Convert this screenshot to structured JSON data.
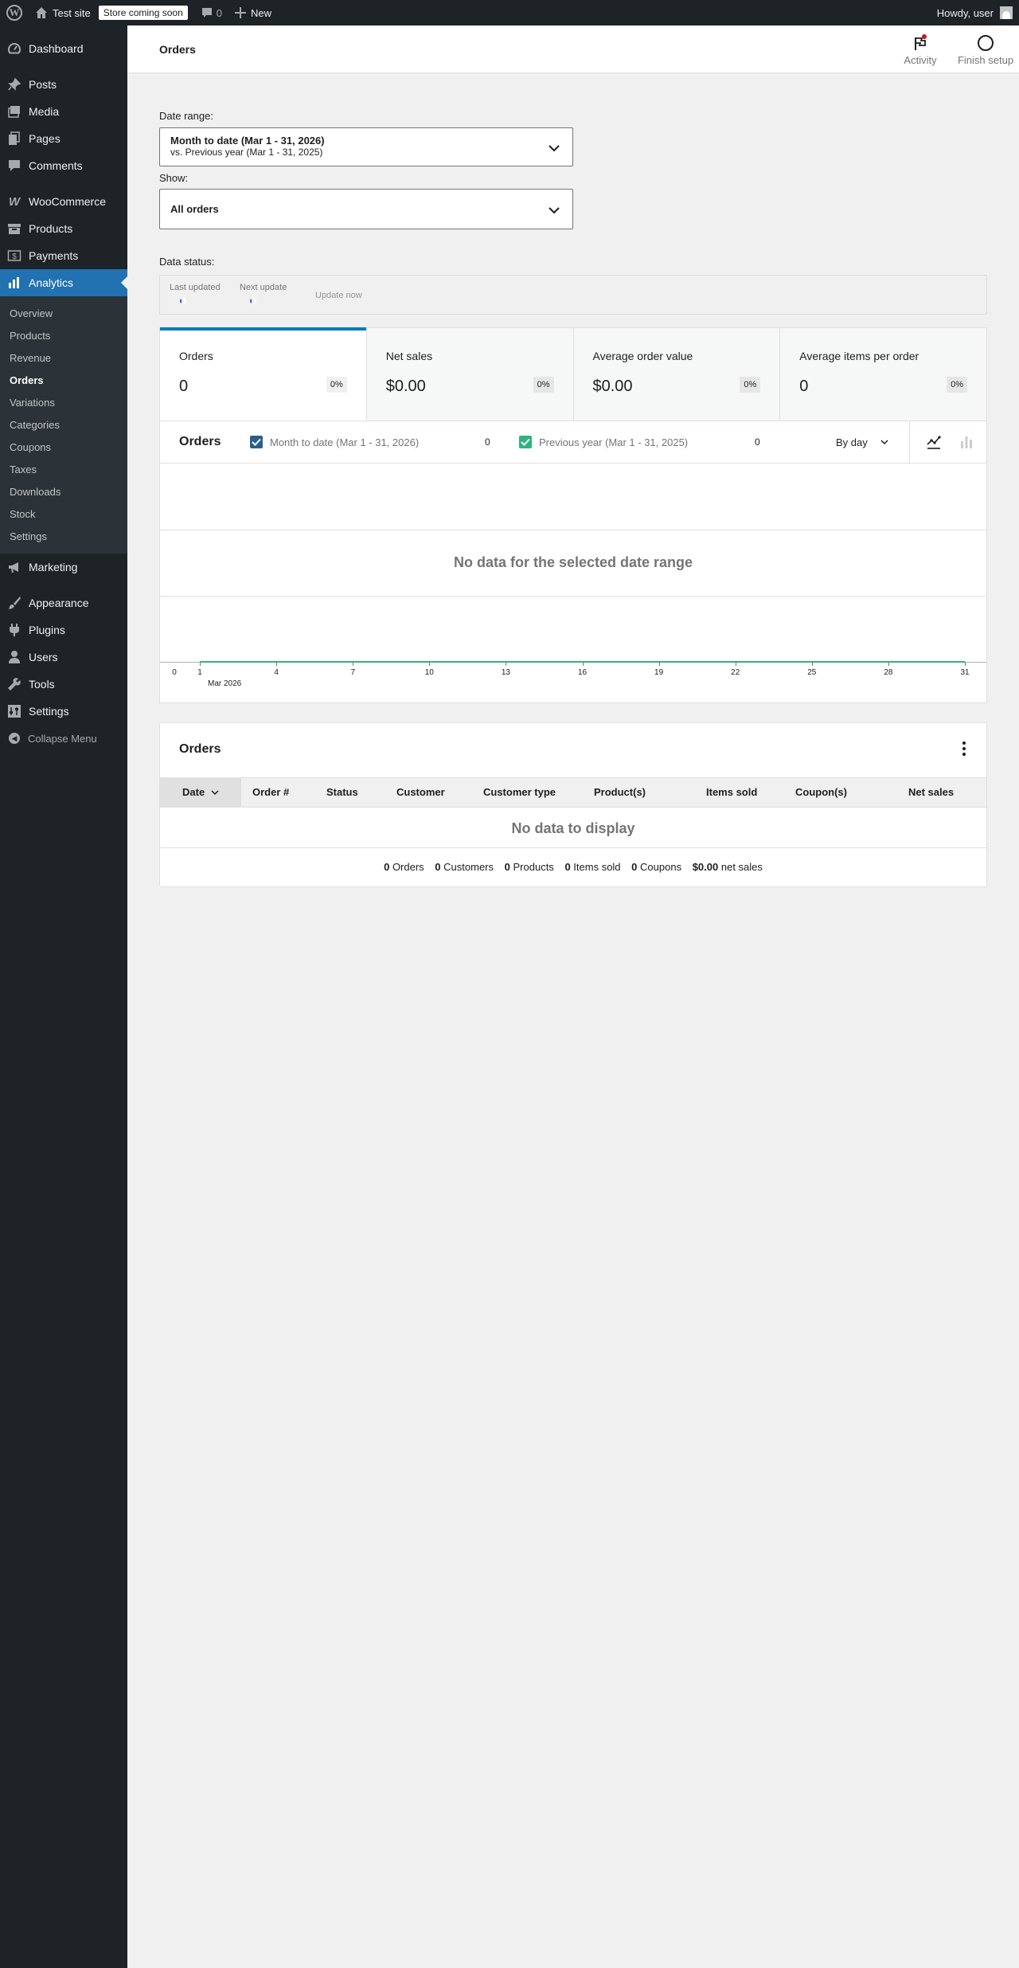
{
  "adminbar": {
    "site_name": "Test site",
    "store_badge": "Store coming soon",
    "comments_count": "0",
    "new_label": "New",
    "howdy": "Howdy, user"
  },
  "sidebar": {
    "items": [
      {
        "label": "Dashboard",
        "icon": "dashboard-icon"
      },
      {
        "label": "Posts",
        "icon": "pin-icon"
      },
      {
        "label": "Media",
        "icon": "media-icon"
      },
      {
        "label": "Pages",
        "icon": "pages-icon"
      },
      {
        "label": "Comments",
        "icon": "comment-icon"
      },
      {
        "label": "WooCommerce",
        "icon": "woo-icon"
      },
      {
        "label": "Products",
        "icon": "archive-icon"
      },
      {
        "label": "Payments",
        "icon": "dollar-icon"
      },
      {
        "label": "Analytics",
        "icon": "chart-bar-icon"
      },
      {
        "label": "Marketing",
        "icon": "megaphone-icon"
      },
      {
        "label": "Appearance",
        "icon": "brush-icon"
      },
      {
        "label": "Plugins",
        "icon": "plugin-icon"
      },
      {
        "label": "Users",
        "icon": "user-icon"
      },
      {
        "label": "Tools",
        "icon": "wrench-icon"
      },
      {
        "label": "Settings",
        "icon": "settings-icon"
      }
    ],
    "analytics_submenu": [
      "Overview",
      "Products",
      "Revenue",
      "Orders",
      "Variations",
      "Categories",
      "Coupons",
      "Taxes",
      "Downloads",
      "Stock",
      "Settings"
    ],
    "collapse_label": "Collapse Menu"
  },
  "header": {
    "title": "Orders",
    "activity_label": "Activity",
    "finish_setup_label": "Finish setup"
  },
  "filters": {
    "date_range_label": "Date range:",
    "date_range_value": "Month to date (Mar 1 - 31, 2026)",
    "date_range_compare": "vs. Previous year (Mar 1 - 31, 2025)",
    "show_label": "Show:",
    "show_value": "All orders"
  },
  "data_status": {
    "label": "Data status:",
    "last_updated": "Last updated",
    "next_update": "Next update",
    "update_now": "Update now"
  },
  "summary": [
    {
      "label": "Orders",
      "value": "0",
      "delta": "0%"
    },
    {
      "label": "Net sales",
      "value": "$0.00",
      "delta": "0%"
    },
    {
      "label": "Average order value",
      "value": "$0.00",
      "delta": "0%"
    },
    {
      "label": "Average items per order",
      "value": "0",
      "delta": "0%"
    }
  ],
  "chart": {
    "title": "Orders",
    "legend": [
      {
        "label": "Month to date (Mar 1 - 31, 2026)",
        "value": "0",
        "color": "#2c5f8a"
      },
      {
        "label": "Previous year (Mar 1 - 31, 2025)",
        "value": "0",
        "color": "#2fb37c"
      }
    ],
    "interval": "By day",
    "no_data": "No data for the selected date range",
    "month_label": "Mar 2026"
  },
  "chart_data": {
    "type": "line",
    "title": "Orders",
    "x": [
      0,
      1,
      4,
      7,
      10,
      13,
      16,
      19,
      22,
      25,
      28,
      31
    ],
    "series": [
      {
        "name": "Month to date (Mar 1 - 31, 2026)",
        "values": [
          null,
          0,
          0,
          0,
          0,
          0,
          0,
          0,
          0,
          0,
          0,
          0
        ]
      },
      {
        "name": "Previous year (Mar 1 - 31, 2025)",
        "values": [
          null,
          0,
          0,
          0,
          0,
          0,
          0,
          0,
          0,
          0,
          0,
          0
        ]
      }
    ],
    "xlim": [
      0,
      31
    ],
    "xlabel": "Mar 2026",
    "grid": true
  },
  "table": {
    "title": "Orders",
    "columns": [
      "Date",
      "Order #",
      "Status",
      "Customer",
      "Customer type",
      "Product(s)",
      "Items sold",
      "Coupon(s)",
      "Net sales"
    ],
    "empty": "No data to display",
    "footer": [
      {
        "value": "0",
        "label": "Orders"
      },
      {
        "value": "0",
        "label": "Customers"
      },
      {
        "value": "0",
        "label": "Products"
      },
      {
        "value": "0",
        "label": "Items sold"
      },
      {
        "value": "0",
        "label": "Coupons"
      },
      {
        "value": "$0.00",
        "label": "net sales"
      }
    ]
  }
}
